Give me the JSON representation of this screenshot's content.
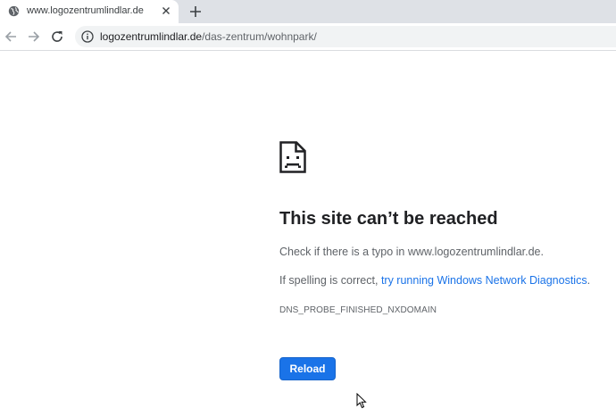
{
  "tab": {
    "title": "www.logozentrumlindlar.de",
    "favicon": "globe-icon"
  },
  "toolbar": {
    "url_host": "logozentrumlindlar.de",
    "url_path": "/das-zentrum/wohnpark/"
  },
  "error": {
    "icon": "sad-page-icon",
    "title": "This site can’t be reached",
    "line1": "Check if there is a typo in www.logozentrumlindlar.de.",
    "line2_prefix": "If spelling is correct, ",
    "line2_link": "try running Windows Network Diagnostics",
    "line2_suffix": ".",
    "code": "DNS_PROBE_FINISHED_NXDOMAIN",
    "reload_label": "Reload"
  },
  "colors": {
    "accent": "#1a73e8",
    "tabstrip": "#dee1e6",
    "text_secondary": "#5f6368"
  }
}
